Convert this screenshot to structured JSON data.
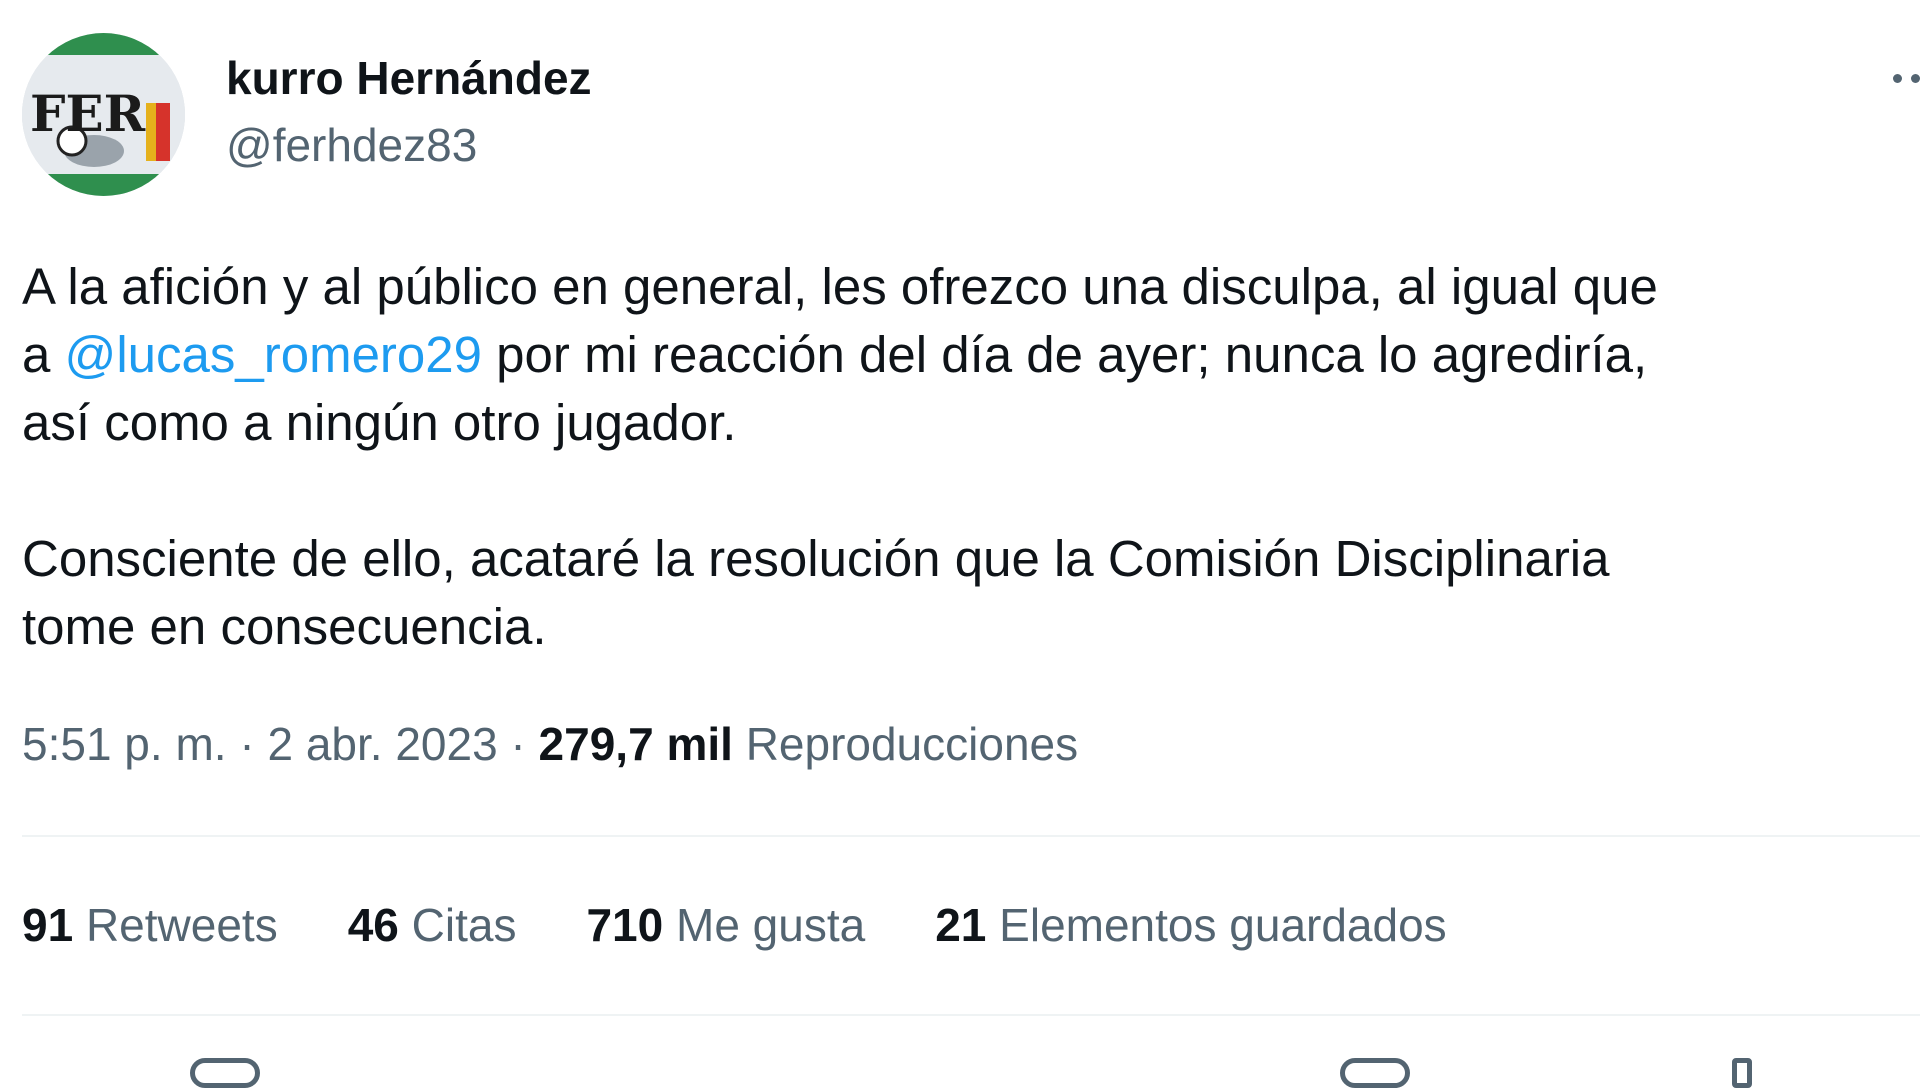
{
  "author": {
    "name": "kurro Hernández",
    "handle": "@ferhdez83",
    "avatar_text": "FER"
  },
  "more_icon": "more-horizontal-icon",
  "tweet": {
    "paragraph1": {
      "line1": "A la afición y al público en general, les ofrezco una disculpa, al igual que",
      "line2_before_mention": "a ",
      "mention": "@lucas_romero29",
      "line2_after_mention": " por mi reacción del día de ayer; nunca lo agrediría,",
      "line3": "así como a ningún otro jugador."
    },
    "paragraph2": {
      "line1": "Consciente de ello, acataré la resolución que la Comisión Disciplinaria",
      "line2": "tome en consecuencia."
    }
  },
  "meta": {
    "time": "5:51 p. m.",
    "separator": " · ",
    "date": "2 abr. 2023",
    "views_count": "279,7 mil",
    "views_label": "Reproducciones"
  },
  "stats": [
    {
      "count": "91",
      "label": "Retweets"
    },
    {
      "count": "46",
      "label": "Citas"
    },
    {
      "count": "710",
      "label": "Me gusta"
    },
    {
      "count": "21",
      "label": "Elementos guardados"
    }
  ],
  "colors": {
    "text_primary": "#0f1419",
    "text_secondary": "#536471",
    "link": "#1d9bf0",
    "divider": "#eff3f4"
  }
}
